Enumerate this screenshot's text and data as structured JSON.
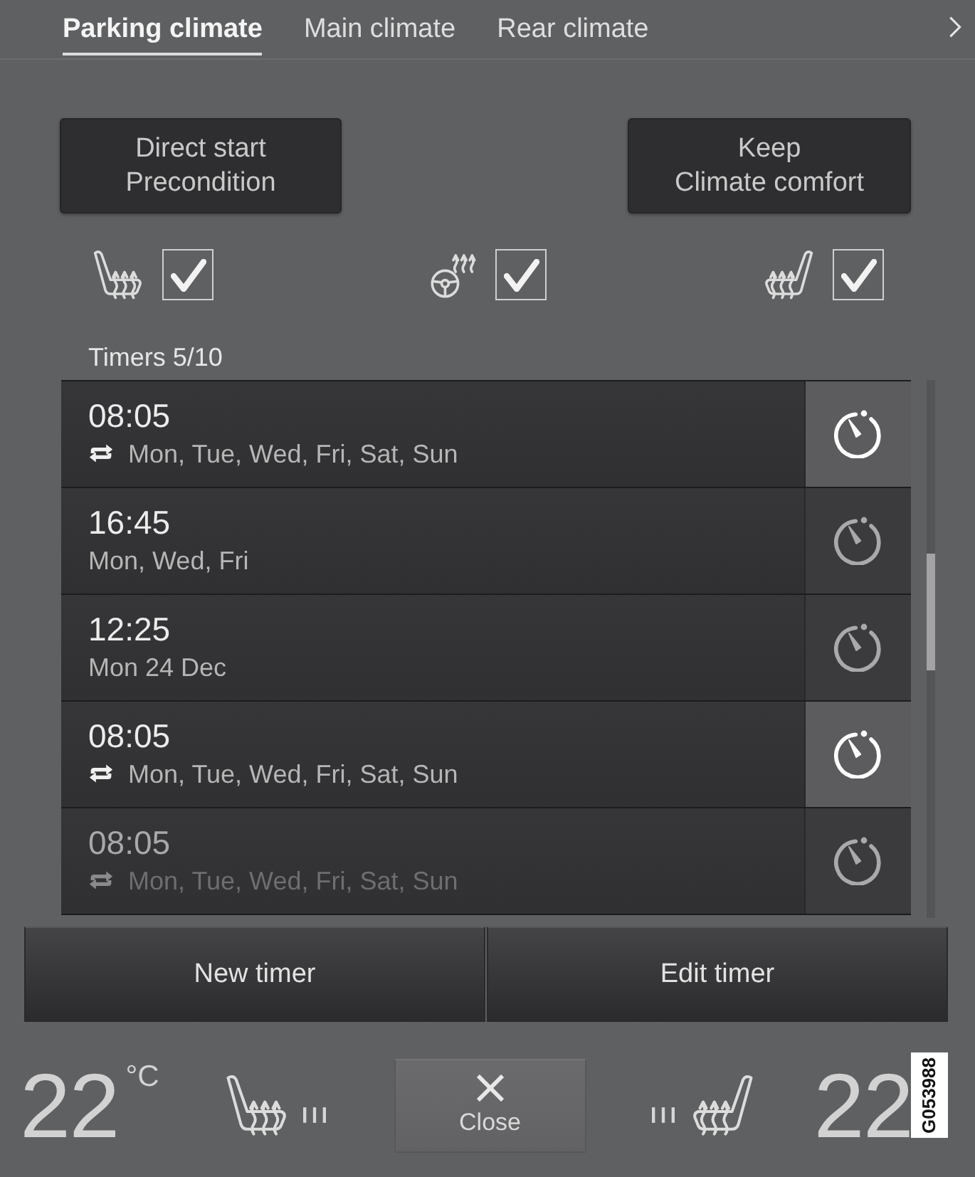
{
  "tabs": [
    {
      "label": "Parking climate",
      "selected": true
    },
    {
      "label": "Main climate",
      "selected": false
    },
    {
      "label": "Rear climate",
      "selected": false
    }
  ],
  "mode_buttons": [
    {
      "lines": [
        "Direct start",
        "Precondition"
      ]
    },
    {
      "lines": [
        "Keep",
        "Climate comfort"
      ]
    }
  ],
  "heating_options": [
    {
      "kind": "seat_left",
      "checked": true
    },
    {
      "kind": "steering_wheel",
      "checked": true
    },
    {
      "kind": "seat_right",
      "checked": true
    }
  ],
  "timers": {
    "title": "Timers 5/10",
    "items": [
      {
        "time": "08:05",
        "days": "Mon, Tue, Wed, Fri, Sat, Sun",
        "repeat": true,
        "on": true
      },
      {
        "time": "16:45",
        "days": "Mon, Wed, Fri",
        "repeat": false,
        "on": false
      },
      {
        "time": "12:25",
        "days": "Mon 24 Dec",
        "repeat": false,
        "on": false
      },
      {
        "time": "08:05",
        "days": "Mon, Tue, Wed, Fri, Sat, Sun",
        "repeat": true,
        "on": true
      },
      {
        "time": "08:05",
        "days": "Mon, Tue, Wed, Fri, Sat, Sun",
        "repeat": true,
        "on": false
      }
    ]
  },
  "actions": [
    "New timer",
    "Edit timer"
  ],
  "climate_bar": {
    "left": {
      "temperature": "22",
      "unit": "°C",
      "seat_heat": {
        "level": 0
      }
    },
    "close": "Close",
    "right": {
      "temperature": "22",
      "seat_heat": {
        "level": 0
      }
    }
  },
  "figure_code": "G053988"
}
